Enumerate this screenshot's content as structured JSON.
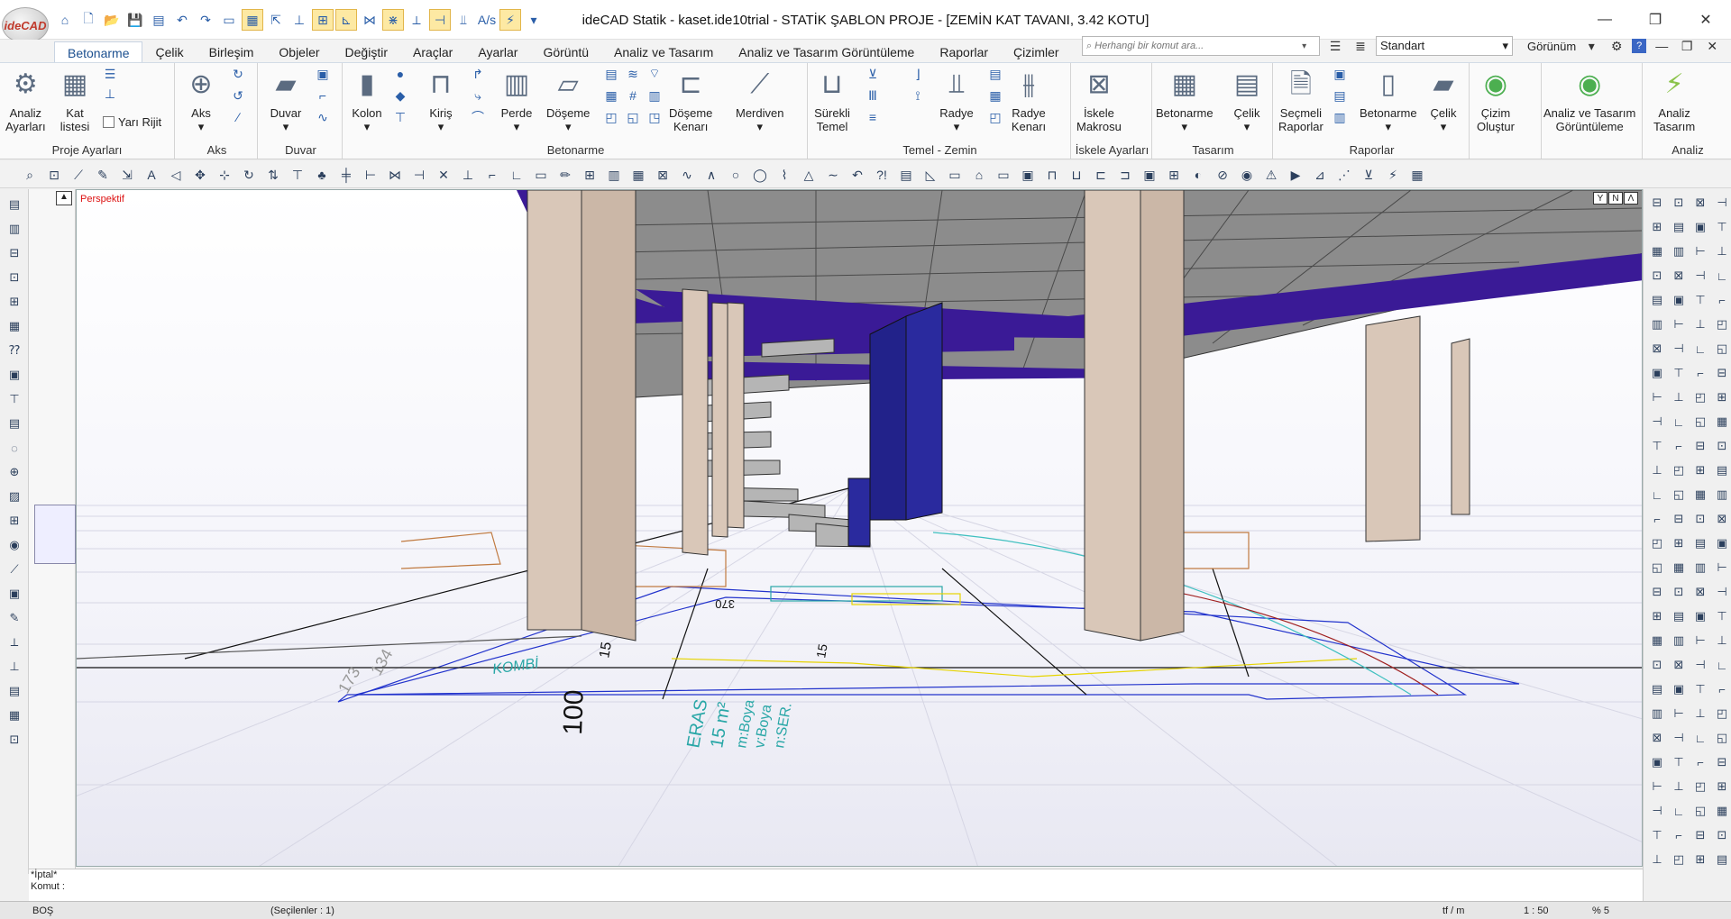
{
  "app": {
    "logo_text": "ideCAD",
    "title": "ideCAD Statik - kaset.ide10trial - STATİK ŞABLON PROJE - [ZEMİN KAT TAVANI,  3.42 KOTU]"
  },
  "window_controls": {
    "minimize": "—",
    "maximize": "❐",
    "close": "✕"
  },
  "quick_access": [
    "⌂",
    "🗋",
    "📂",
    "💾",
    "▤",
    "↶",
    "↷",
    "▭",
    "▦",
    "⇱",
    "⊥",
    "⊞",
    "⊾",
    "⋈",
    "⋇",
    "⟂",
    "⊣",
    "⫫",
    "A/s",
    "⚡",
    "▾"
  ],
  "tabs": [
    "Betonarme",
    "Çelik",
    "Birleşim",
    "Objeler",
    "Değiştir",
    "Araçlar",
    "Ayarlar",
    "Görüntü",
    "Analiz ve Tasarım",
    "Analiz ve Tasarım Görüntüleme",
    "Raporlar",
    "Çizimler"
  ],
  "active_tab": "Betonarme",
  "search": {
    "placeholder": "Herhangi bir komut ara..."
  },
  "standart": {
    "value": "Standart",
    "gorunum_label": "Görünüm"
  },
  "ribbon": {
    "groups": {
      "proje": "Proje Ayarları",
      "aks": "Aks",
      "duvar": "Duvar",
      "betonarme": "Betonarme",
      "temel": "Temel - Zemin",
      "iskele": "İskele Ayarları",
      "tasarim": "Tasarım",
      "raporlar": "Raporlar",
      "analiz": "Analiz"
    },
    "buttons": {
      "analiz_ayarlari": "Analiz\nAyarları",
      "kat_listesi": "Kat\nlistesi",
      "yari_rijit": "Yarı Rijit",
      "aks": "Aks",
      "duvar": "Duvar",
      "kolon": "Kolon",
      "kiris": "Kiriş",
      "perde": "Perde",
      "doseme": "Döşeme",
      "doseme_kenari": "Döşeme\nKenarı",
      "merdiven": "Merdiven",
      "surekli_temel": "Sürekli\nTemel",
      "radye": "Radye",
      "radye_kenari": "Radye\nKenarı",
      "iskele_makrosu": "İskele\nMakrosu",
      "betonarme_t": "Betonarme",
      "celik_t": "Çelik",
      "secmeli_raporlar": "Seçmeli\nRaporlar",
      "betonarme_r": "Betonarme",
      "celik_r": "Çelik",
      "cizim_olustur": "Çizim\nOluştur",
      "analiz_gorunt": "Analiz ve Tasarım\nGörüntüleme",
      "analiz_tasarim": "Analiz\nTasarım"
    }
  },
  "viewport": {
    "mode_label": "Perspektif",
    "view_controls": [
      "Y",
      "N",
      "Λ"
    ],
    "labels": {
      "kombi": "KOMBİ",
      "dim_100": "100",
      "dim_370": "370",
      "dim_15a": "15",
      "dim_15b": "15",
      "teras": "ERAS",
      "area": "15 m²",
      "boya1": "m:Boya",
      "boya2": "v:Boya",
      "ser": "n:SER.",
      "rot_dims": "173",
      "rot_dims2": "134"
    }
  },
  "command": {
    "line1": "*İptal*",
    "line2": "Komut :"
  },
  "status": {
    "mode": "BOŞ",
    "selected": "(Seçilenler : 1)",
    "unit": "tf / m",
    "scale": "1 : 50",
    "percent": "% 5"
  },
  "colors": {
    "slab": "#8c8c8c",
    "beam": "#3a1a96",
    "column": "#d9c7b8",
    "shear_wall": "#2a2a9e",
    "accent": "#1b4f8f"
  }
}
